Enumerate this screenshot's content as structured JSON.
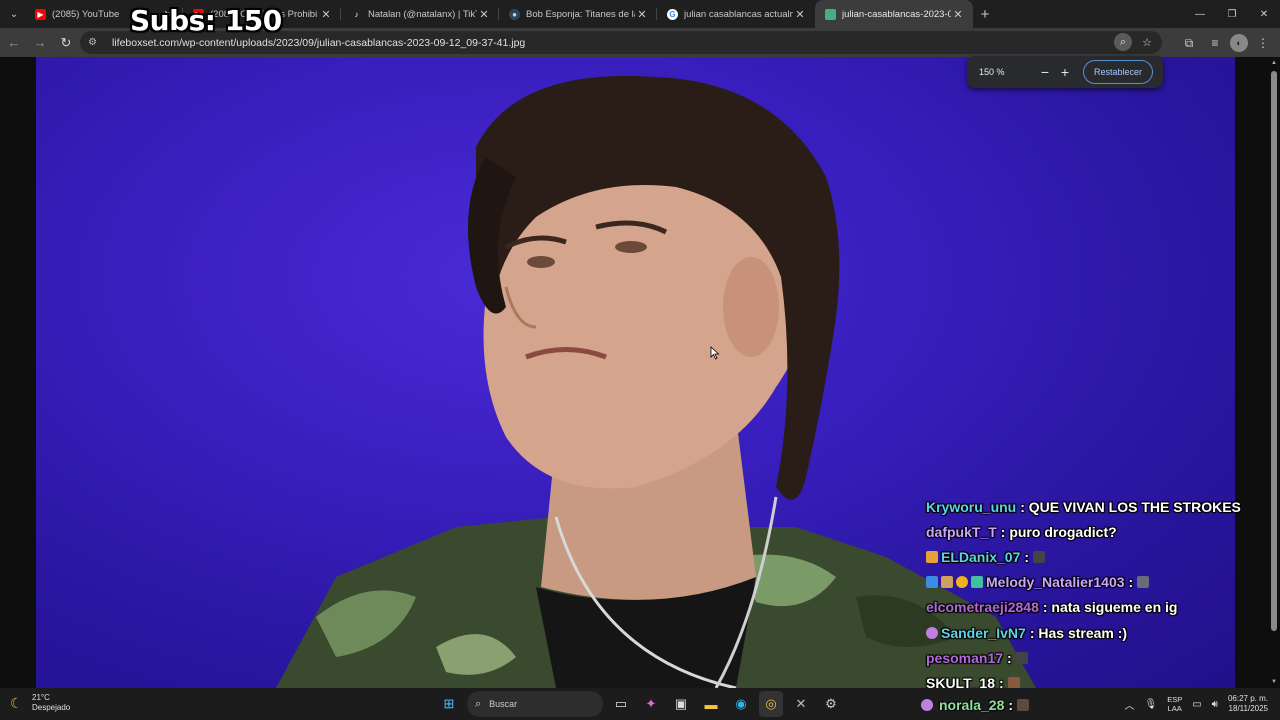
{
  "browser": {
    "tabs": [
      {
        "title": "(2085) YouTube",
        "icon": "youtube-icon",
        "color": "#ff0000"
      },
      {
        "title": "(2085) Canciones Prohibi",
        "icon": "youtube-icon",
        "color": "#ff0000"
      },
      {
        "title": "Natalan (@natalanx) | TikTok",
        "icon": "tiktok-icon",
        "color": "#111111"
      },
      {
        "title": "Bob Esponja: Titanes de las mar",
        "icon": "steam-icon",
        "color": "#1b2838"
      },
      {
        "title": "julian casablancas actualmente",
        "icon": "google-icon",
        "color": "#ffffff"
      },
      {
        "title": "julian-casablancas-2023-09-12",
        "icon": "image-icon",
        "color": "#3fb27f",
        "active": true
      }
    ],
    "url": "lifeboxset.com/wp-content/uploads/2023/09/julian-casablancas-2023-09-12_09-37-41.jpg",
    "zoom_level": "150 %",
    "zoom_reset_label": "Restablecer",
    "zoom_minus": "−",
    "zoom_plus": "+"
  },
  "overlay": {
    "subs_text": "Subs: 150"
  },
  "chat": [
    {
      "user": "Kryworu_unu",
      "user_color": "#5fd3e6",
      "message": ": QUE VIVAN LOS THE STROKES",
      "badges": []
    },
    {
      "user": "dafpukT_T",
      "user_color": "#c9a6ff",
      "message": ": puro drogadict?",
      "badges": []
    },
    {
      "user": "ELDanix_07",
      "user_color": "#5fd3e6",
      "message": ":",
      "badges": [
        "crown-badge"
      ],
      "emote": true
    },
    {
      "user": "Melody_Natalier1403",
      "user_color": "#c9a6ff",
      "message": ":",
      "badges": [
        "badge-1",
        "badge-2",
        "badge-3",
        "badge-4"
      ],
      "emote": true
    },
    {
      "user": "elcometraeji2848",
      "user_color": "#b06ad8",
      "message": ": nata sigueme en ig",
      "badges": []
    },
    {
      "user": "Sander_IvN7",
      "user_color": "#5fd3e6",
      "message": ": Has stream :)",
      "badges": [
        "bunny-badge"
      ]
    },
    {
      "user": "pesoman17",
      "user_color": "#b06ad8",
      "message": ":",
      "badges": [],
      "emote": true
    },
    {
      "user": "SKULT_18",
      "user_color": "#ffffff",
      "message": ":",
      "badges": [],
      "emote": true
    }
  ],
  "taskbar": {
    "weather_temp": "21°C",
    "weather_desc": "Despejado",
    "search_placeholder": "Buscar",
    "lang_top": "ESP",
    "lang_bottom": "LAA",
    "time": "06:27 p. m.",
    "date": "18/11/2025",
    "chat_user": "norala_28",
    "chat_message": ":"
  }
}
